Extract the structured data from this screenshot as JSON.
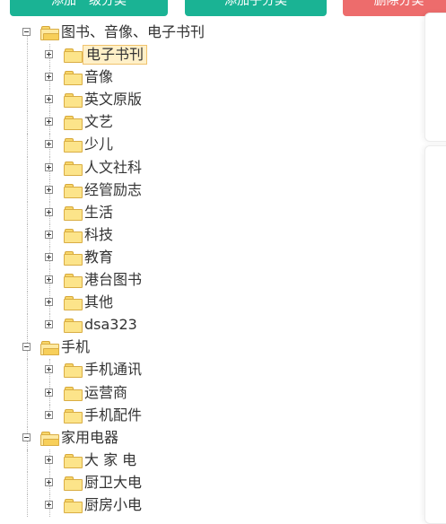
{
  "toolbar": {
    "add_root_label": "添加一级分类",
    "add_sub_label": "添加子分类",
    "delete_label": "删除分类"
  },
  "colors": {
    "primary_button": "#1ab394",
    "danger_button": "#ed6c6c",
    "selected_bg": "#fff0c8",
    "folder": "#fce48a"
  },
  "tree": {
    "root1": {
      "label": "图书、音像、电子书刊",
      "expanded": true,
      "children": [
        "电子书刊",
        "音像",
        "英文原版",
        "文艺",
        "少儿",
        "人文社科",
        "经管励志",
        "生活",
        "科技",
        "教育",
        "港台图书",
        "其他",
        "dsa323"
      ],
      "selected": "电子书刊"
    },
    "root2": {
      "label": "手机",
      "expanded": true,
      "children": [
        "手机通讯",
        "运营商",
        "手机配件"
      ]
    },
    "root3": {
      "label": "家用电器",
      "expanded": true,
      "children": [
        "大 家 电",
        "厨卫大电",
        "厨房小电"
      ]
    }
  },
  "icons": {
    "expand": "plus-square-icon",
    "collapse": "minus-square-icon",
    "folder": "folder-icon",
    "folder_open": "folder-open-icon"
  }
}
